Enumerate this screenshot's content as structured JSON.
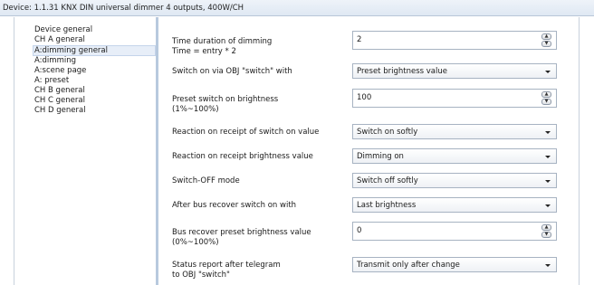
{
  "window": {
    "title": "Device: 1.1.31  KNX DIN universal dimmer 4 outputs, 400W/CH"
  },
  "sidebar": {
    "items": [
      {
        "label": "Device general",
        "selected": false
      },
      {
        "label": "CH A general",
        "selected": false
      },
      {
        "label": "A:dimming general",
        "selected": true
      },
      {
        "label": "A:dimming",
        "selected": false
      },
      {
        "label": "A:scene page",
        "selected": false
      },
      {
        "label": "A: preset",
        "selected": false
      },
      {
        "label": "CH B general",
        "selected": false
      },
      {
        "label": "CH C general",
        "selected": false
      },
      {
        "label": "CH D general",
        "selected": false
      }
    ]
  },
  "params": [
    {
      "type": "spin",
      "label_line1": "Time duration of dimming",
      "label_line2": "Time = entry * 2",
      "value": "2"
    },
    {
      "type": "select",
      "label_line1": "Switch on via OBJ \"switch\" with",
      "label_line2": "",
      "value": "Preset brightness value"
    },
    {
      "type": "spin",
      "label_line1": "Preset switch on brightness",
      "label_line2": "(1%~100%)",
      "value": "100"
    },
    {
      "type": "select",
      "label_line1": "Reaction on receipt of switch on value",
      "label_line2": "",
      "value": "Switch on softly"
    },
    {
      "type": "select",
      "label_line1": "Reaction on receipt brightness value",
      "label_line2": "",
      "value": "Dimming on"
    },
    {
      "type": "select",
      "label_line1": "Switch-OFF mode",
      "label_line2": "",
      "value": "Switch off softly"
    },
    {
      "type": "select",
      "label_line1": "After bus recover switch on with",
      "label_line2": "",
      "value": "Last brightness"
    },
    {
      "type": "spin",
      "label_line1": "Bus recover preset brightness value",
      "label_line2": "(0%~100%)",
      "value": "0"
    },
    {
      "type": "select",
      "label_line1": "Status report after telegram",
      "label_line2": "to OBJ \"switch\"",
      "value": "Transmit only after change"
    }
  ]
}
